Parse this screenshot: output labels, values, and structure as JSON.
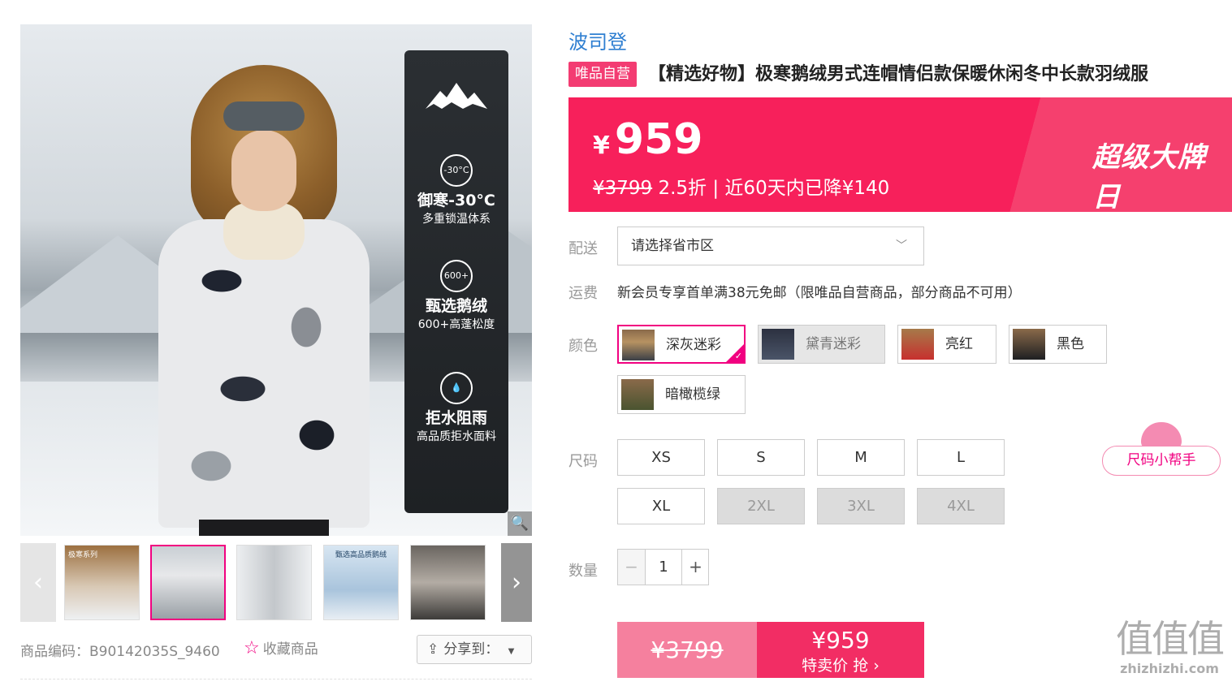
{
  "gallery": {
    "features": [
      {
        "icon_text": "-30°C",
        "title": "御寒-30°C",
        "sub": "多重锁温体系"
      },
      {
        "icon_text": "600+",
        "title": "甄选鹅绒",
        "sub": "600+高蓬松度"
      },
      {
        "icon_text": "",
        "title": "拒水阻雨",
        "sub": "高品质拒水面料"
      }
    ],
    "thumbs": [
      {
        "caption": "极寒系列"
      },
      {
        "caption": ""
      },
      {
        "caption": ""
      },
      {
        "caption": "甄选高品质鹅绒"
      },
      {
        "caption": ""
      }
    ],
    "prev_glyph": "‹",
    "next_glyph": "›",
    "zoom_glyph": "🔍"
  },
  "meta": {
    "product_code": "商品编码：B90142035S_9460",
    "favorite_label": "收藏商品",
    "favorite_icon": "star-icon",
    "share_label": "分享到："
  },
  "product": {
    "brand": "波司登",
    "self_badge": "唯品自营",
    "title": "【精选好物】极寒鹅绒男式连帽情侣款保暖休闲冬中长款羽绒服"
  },
  "price": {
    "currency": "¥",
    "now": "959",
    "old": "¥3799",
    "discount_text": "2.5折 | 近60天内已降¥140",
    "promo": "超级大牌日"
  },
  "delivery": {
    "label": "配送",
    "placeholder": "请选择省市区"
  },
  "shipping": {
    "label": "运费",
    "text": "新会员专享首单满38元免邮（限唯品自营商品，部分商品不可用）"
  },
  "colors": {
    "label": "颜色",
    "options": [
      {
        "label": "深灰迷彩",
        "state": "selected"
      },
      {
        "label": "黛青迷彩",
        "state": "disabled"
      },
      {
        "label": "亮红",
        "state": "normal"
      },
      {
        "label": "黑色",
        "state": "normal"
      },
      {
        "label": "暗橄榄绿",
        "state": "normal"
      }
    ]
  },
  "sizes": {
    "label": "尺码",
    "options": [
      {
        "label": "XS",
        "available": true
      },
      {
        "label": "S",
        "available": true
      },
      {
        "label": "M",
        "available": true
      },
      {
        "label": "L",
        "available": true
      },
      {
        "label": "XL",
        "available": true
      },
      {
        "label": "2XL",
        "available": false
      },
      {
        "label": "3XL",
        "available": false
      },
      {
        "label": "4XL",
        "available": false
      }
    ],
    "helper": "尺码小帮手"
  },
  "quantity": {
    "label": "数量",
    "value": "1",
    "minus": "−",
    "plus": "+"
  },
  "buy": {
    "old_price": "¥3799",
    "now_price": "¥959",
    "action": "特卖价 抢 ›"
  },
  "watermark": {
    "big": "值值值",
    "small": "zhizhizhi.com"
  },
  "colors_theme": {
    "accent": "#f10180",
    "banner": "#f7205b",
    "brand_link": "#2f7fd1"
  }
}
